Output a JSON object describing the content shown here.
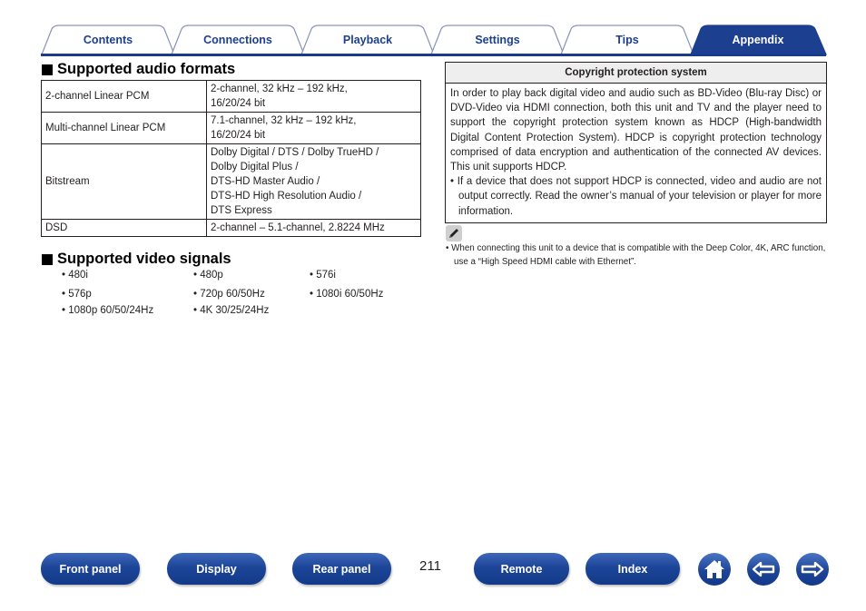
{
  "tabs": [
    {
      "label": "Contents",
      "active": false
    },
    {
      "label": "Connections",
      "active": false
    },
    {
      "label": "Playback",
      "active": false
    },
    {
      "label": "Settings",
      "active": false
    },
    {
      "label": "Tips",
      "active": false
    },
    {
      "label": "Appendix",
      "active": true
    }
  ],
  "audio": {
    "heading": "Supported audio formats",
    "rows": [
      {
        "format": "2-channel Linear PCM",
        "spec": [
          "2-channel, 32 kHz – 192 kHz,",
          "16/20/24 bit"
        ]
      },
      {
        "format": "Multi-channel Linear PCM",
        "spec": [
          "7.1-channel, 32 kHz – 192 kHz,",
          "16/20/24 bit"
        ]
      },
      {
        "format": "Bitstream",
        "spec": [
          "Dolby Digital / DTS / Dolby TrueHD /",
          "Dolby Digital Plus /",
          "DTS-HD Master Audio /",
          "DTS-HD High Resolution Audio /",
          "DTS Express"
        ]
      },
      {
        "format": "DSD",
        "spec": [
          "2-channel – 5.1-channel, 2.8224 MHz"
        ]
      }
    ]
  },
  "video": {
    "heading": "Supported video signals",
    "items": [
      "480i",
      "480p",
      "576i",
      "576p",
      "720p 60/50Hz",
      "1080i 60/50Hz",
      "1080p 60/50/24Hz",
      "4K 30/25/24Hz"
    ]
  },
  "copyright": {
    "title": "Copyright protection system",
    "body": "In order to play back digital video and audio such as BD-Video (Blu-ray Disc) or DVD-Video via HDMI connection, both this unit and TV and the player need to support the copyright protection system known as HDCP (High-bandwidth Digital Content Protection System). HDCP is copyright protection technology comprised of data encryption and authentication of the connected AV devices. This unit supports HDCP.",
    "bullet": "• If a device that does not support HDCP is connected, video and audio are not output correctly. Read the owner’s manual of your television or player for more information."
  },
  "note": {
    "icon": "pencil-icon",
    "text": "• When connecting this unit to a device that is compatible with the Deep Color, 4K, ARC function, use a “High Speed HDMI cable with Ethernet”."
  },
  "footer": {
    "buttons": [
      "Front panel",
      "Display",
      "Rear panel",
      "Remote",
      "Index"
    ],
    "page_number": "211",
    "icons": [
      "home-icon",
      "back-arrow-icon",
      "forward-arrow-icon"
    ]
  },
  "colors": {
    "brand_blue": "#1d3f8f",
    "tab_line": "#1a3a8a"
  }
}
